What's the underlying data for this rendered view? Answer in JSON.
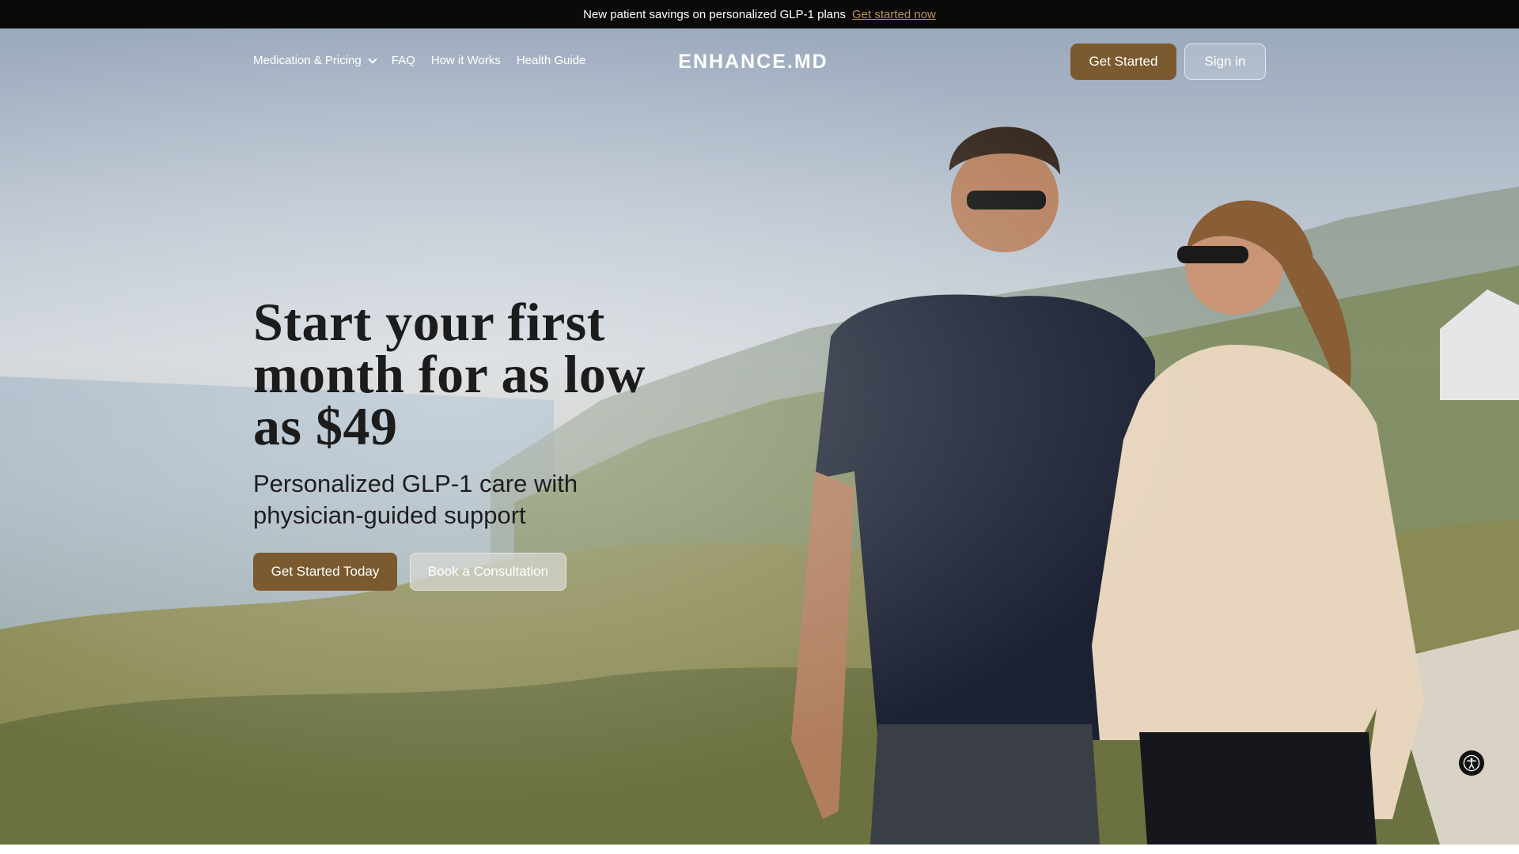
{
  "announcement": {
    "text": "New patient savings on personalized GLP-1 plans",
    "link": "Get started now"
  },
  "nav": {
    "links": [
      {
        "label": "Medication & Pricing",
        "icon": "chevron-down-icon"
      },
      {
        "label": "FAQ"
      },
      {
        "label": "How it Works"
      },
      {
        "label": "Health Guide"
      }
    ],
    "logo": "ENHANCE.MD",
    "get_started": "Get Started",
    "sign_in": "Sign in"
  },
  "hero": {
    "headline": "Start your first month for as low as $49",
    "subheadline": "Personalized GLP-1 care with physician-guided support",
    "primary_cta": "Get Started Today",
    "secondary_cta": "Book a Consultation",
    "image": "photo of a smiling couple walking along a coastal cliff path"
  },
  "accessibility": {
    "icon": "accessibility-icon"
  },
  "colors": {
    "brand_brown": "#7a5a2e",
    "announcement_bg": "#0a0a0a",
    "link_gold": "#b8935a"
  }
}
